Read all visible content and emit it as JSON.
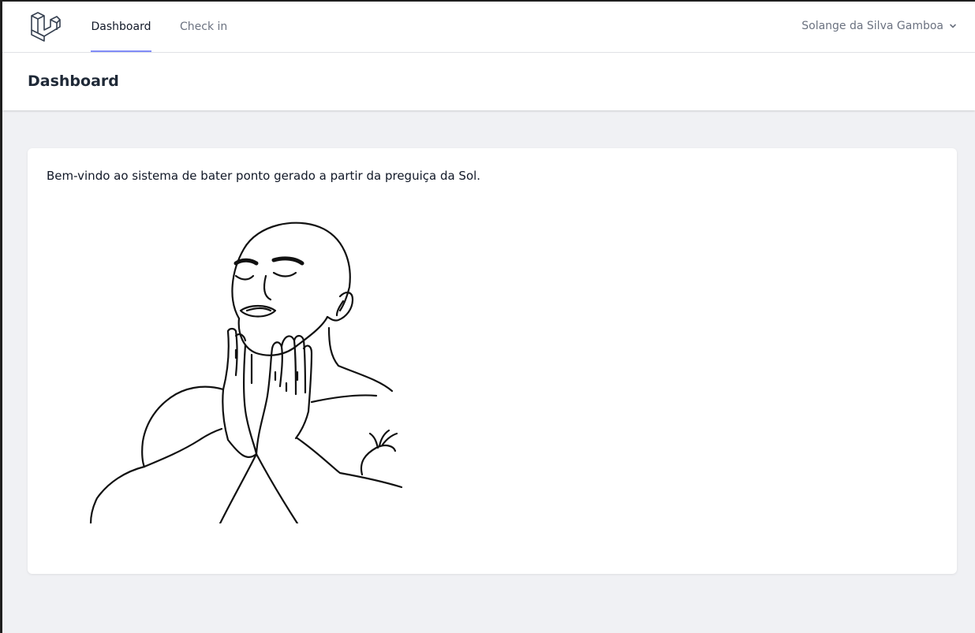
{
  "nav": {
    "logo_icon": "laravel-logo-icon",
    "links": [
      {
        "label": "Dashboard",
        "active": true
      },
      {
        "label": "Check in",
        "active": false
      }
    ],
    "user_name": "Solange da Silva Gamboa",
    "user_menu_icon": "chevron-down-icon"
  },
  "header": {
    "title": "Dashboard"
  },
  "content": {
    "welcome_text": "Bem-vindo ao sistema de bater ponto gerado a partir da preguiça da Sol.",
    "image_subject": "feels-good-man-drawing"
  },
  "colors": {
    "active_tab_underline": "#818cf8",
    "page_background": "#f0f1f4",
    "card_background": "#ffffff"
  }
}
